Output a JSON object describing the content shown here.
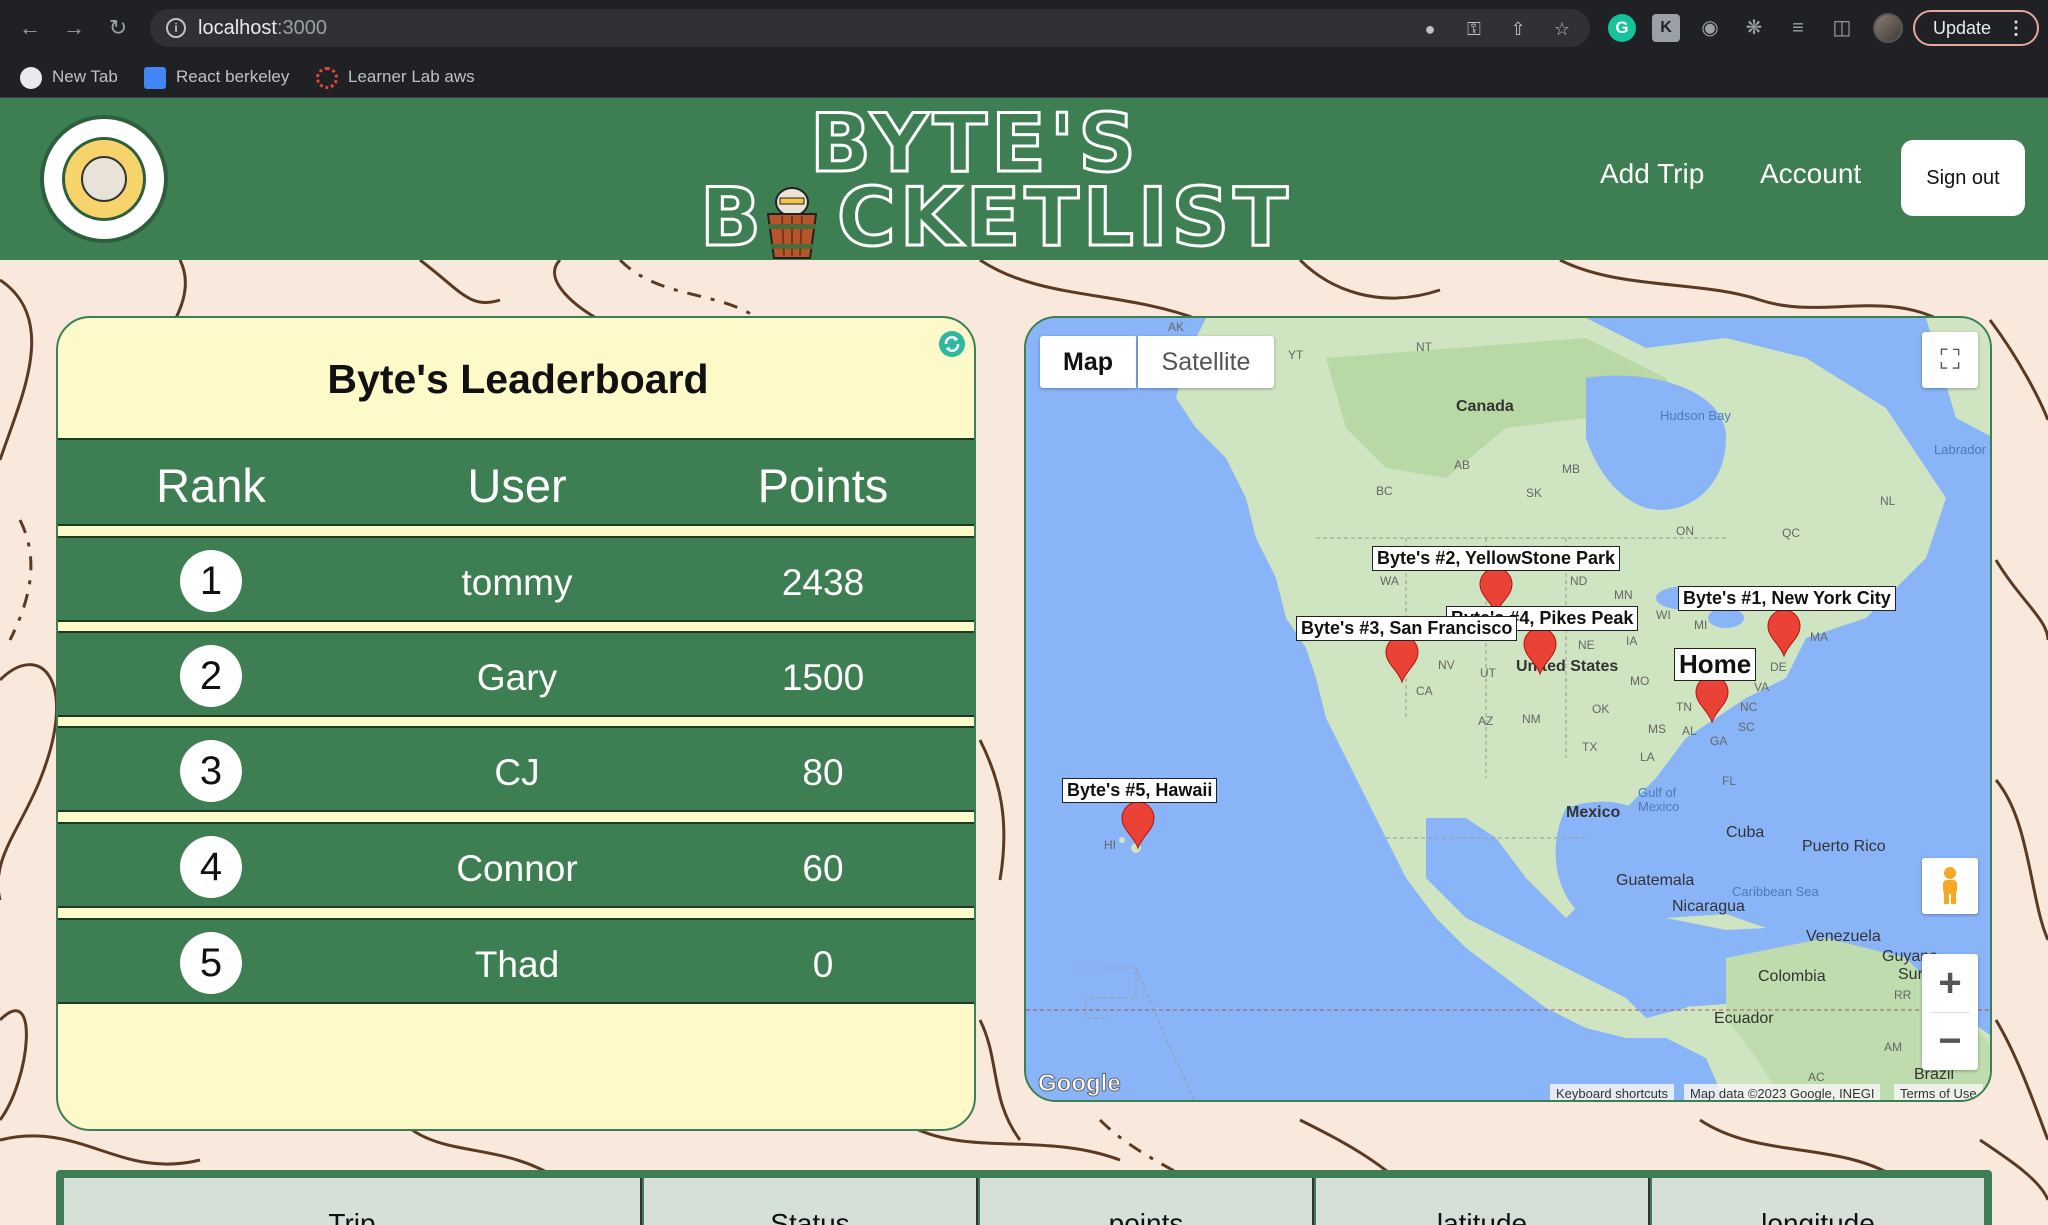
{
  "browser": {
    "url_host": "localhost",
    "url_port": ":3000",
    "bookmarks": [
      "New Tab",
      "React berkeley",
      "Learner Lab aws"
    ],
    "update_label": "Update"
  },
  "header": {
    "brand_line1": "BYTE'S",
    "brand_line2_a": "B",
    "brand_line2_b": "CKETLIST",
    "nav": {
      "add_trip": "Add Trip",
      "account": "Account",
      "sign_out": "Sign out"
    }
  },
  "leaderboard": {
    "title": "Byte's Leaderboard",
    "columns": [
      "Rank",
      "User",
      "Points"
    ],
    "rows": [
      {
        "rank": "1",
        "user": "tommy",
        "points": "2438"
      },
      {
        "rank": "2",
        "user": "Gary",
        "points": "1500"
      },
      {
        "rank": "3",
        "user": "CJ",
        "points": "80"
      },
      {
        "rank": "4",
        "user": "Connor",
        "points": "60"
      },
      {
        "rank": "5",
        "user": "Thad",
        "points": "0"
      }
    ]
  },
  "map": {
    "type_map": "Map",
    "type_satellite": "Satellite",
    "markers": [
      "Byte's #2, YellowStone Park",
      "Byte's #4, Pikes Peak",
      "Byte's #3, San Francisco",
      "Byte's #1, New York City",
      "Home",
      "Byte's #5, Hawaii"
    ],
    "places": {
      "canada": "Canada",
      "united_states": "United States",
      "mexico": "Mexico",
      "cuba": "Cuba",
      "puerto_rico": "Puerto Rico",
      "guatemala": "Guatemala",
      "nicaragua": "Nicaragua",
      "venezuela": "Venezuela",
      "colombia": "Colombia",
      "ecuador": "Ecuador",
      "brazil": "Brazil",
      "guyana": "Guyana",
      "suriname": "Sur",
      "hudson_bay": "Hudson Bay",
      "labrador": "Labrador",
      "gulf_of_mexico": "Gulf of Mexico",
      "caribbean_sea": "Caribbean Sea"
    },
    "state_codes": [
      "AK",
      "YT",
      "NT",
      "AB",
      "MB",
      "BC",
      "SK",
      "ON",
      "QC",
      "NL",
      "WA",
      "ND",
      "MN",
      "WI",
      "MI",
      "NV",
      "UT",
      "NE",
      "IA",
      "MO",
      "CA",
      "AZ",
      "NM",
      "OK",
      "TX",
      "MS",
      "AL",
      "GA",
      "TN",
      "NC",
      "SC",
      "FL",
      "LA",
      "MA",
      "VA",
      "DE",
      "HI",
      "AM",
      "AC",
      "RR"
    ],
    "footer": {
      "keyboard": "Keyboard shortcuts",
      "data": "Map data ©2023 Google, INEGI",
      "terms": "Terms of Use"
    },
    "google": "Google"
  },
  "trips": {
    "columns": [
      "Trip",
      "Status",
      "points",
      "latitude",
      "longitude"
    ]
  },
  "colors": {
    "brand_green": "#3d7f52",
    "leaderboard_bg": "#fef9c8",
    "page_bg": "#f9e8dc",
    "marker_red": "#ea4335"
  }
}
